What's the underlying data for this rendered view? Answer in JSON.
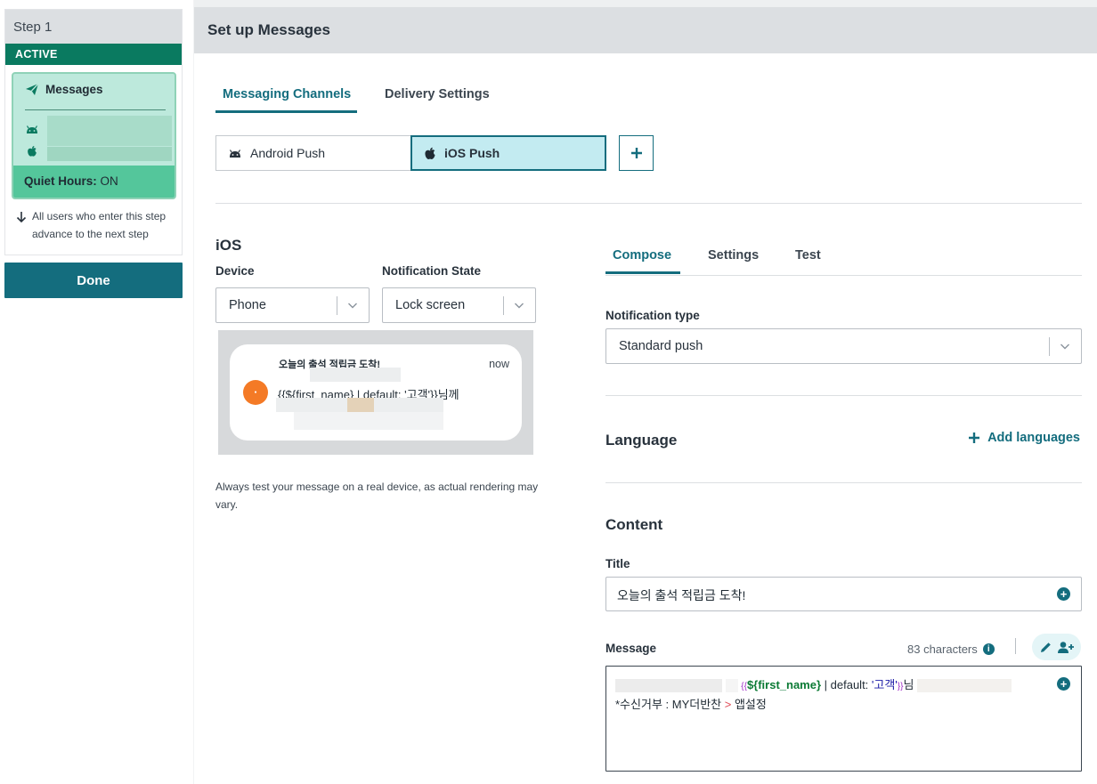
{
  "sidebar": {
    "step_label": "Step 1",
    "status": "ACTIVE",
    "message_card_title": "Messages",
    "quiet_hours_label": "Quiet Hours:",
    "quiet_hours_value": "ON",
    "advance_note": "All users who enter this step advance to the next step",
    "done_label": "Done"
  },
  "header": {
    "title": "Set up Messages"
  },
  "channel_tabs": [
    {
      "label": "Messaging Channels",
      "active": true
    },
    {
      "label": "Delivery Settings",
      "active": false
    }
  ],
  "channels": [
    {
      "label": "Android Push",
      "icon": "android-icon",
      "selected": false
    },
    {
      "label": "iOS Push",
      "icon": "apple-icon",
      "selected": true
    }
  ],
  "preview": {
    "section_title": "iOS",
    "device_label": "Device",
    "device_value": "Phone",
    "state_label": "Notification State",
    "state_value": "Lock screen",
    "notif_title": "오늘의 출석 적립금 도착!",
    "notif_time": "now",
    "notif_body": "{{${first_name} | default: '고객'}}님께",
    "note": "Always test your message on a real device, as actual rendering may vary."
  },
  "compose_tabs": [
    {
      "label": "Compose",
      "active": true
    },
    {
      "label": "Settings",
      "active": false
    },
    {
      "label": "Test",
      "active": false
    }
  ],
  "compose": {
    "notif_type_label": "Notification type",
    "notif_type_value": "Standard push",
    "language_title": "Language",
    "add_languages": "Add languages",
    "content_title": "Content",
    "title_label": "Title",
    "title_value": "오늘의 출석 적립금 도착!",
    "message_label": "Message",
    "char_count": "83 characters",
    "message_line1_open": "{{",
    "message_line1_var": "${first_name}",
    "message_line1_mid": " | default: ",
    "message_line1_str": "'고객'",
    "message_line1_close": "}}",
    "message_line1_suffix": "님",
    "message_line2_pre": "*수신거부 : MY더반찬 ",
    "message_line2_gt": ">",
    "message_line2_post": " 앱설정"
  },
  "colors": {
    "accent": "#146d7e",
    "active_green": "#0a7a60",
    "selected_channel": "#c3ebf1",
    "app_icon": "#f47a26"
  }
}
